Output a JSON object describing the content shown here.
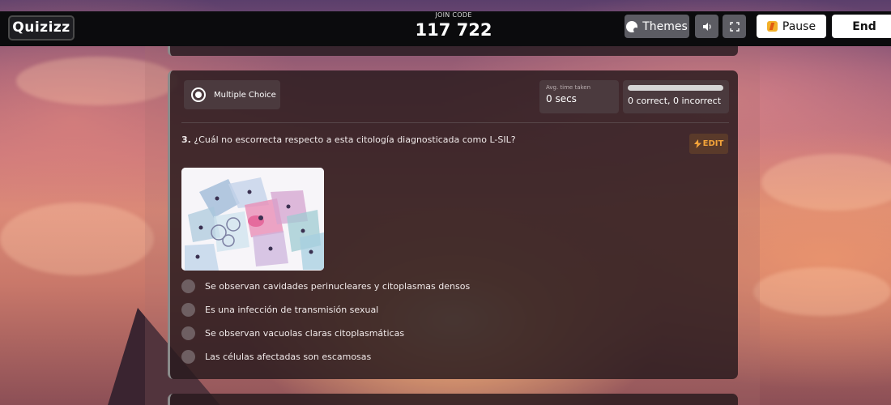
{
  "app": {
    "logo_text": "Quizizz"
  },
  "header": {
    "join_label": "JOIN CODE",
    "join_code": "117 722",
    "themes_label": "Themes",
    "pause_label": "Pause",
    "end_label": "End"
  },
  "question_card": {
    "type_label": "Multiple Choice",
    "avg_time_label": "Avg. time taken",
    "avg_time_value": "0 secs",
    "score_text": "0 correct, 0 incorrect",
    "score_progress": 0,
    "number": "3.",
    "text": "¿Cuál no escorrecta respecto a esta citología diagnosticada como L-SIL?",
    "edit_label": "EDIT",
    "options": [
      "Se observan cavidades perinucleares y citoplasmas densos",
      "Es una infección de transmisión sexual",
      "Se observan vacuolas claras citoplasmáticas",
      "Las células afectadas son escamosas"
    ]
  },
  "colors": {
    "topbar": "#0b0b0d",
    "card": "#281a1e",
    "edit_accent": "#f4a43a",
    "button_gray": "#5c5c63"
  },
  "icons": [
    "palette-icon",
    "speaker-icon",
    "fullscreen-icon",
    "lightning-icon",
    "radio-selected-icon"
  ]
}
